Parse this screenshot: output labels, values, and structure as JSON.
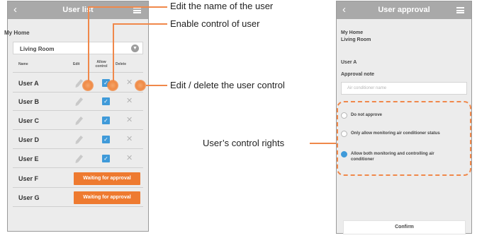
{
  "left_screen": {
    "title": "User list",
    "home": "My Home",
    "room": "Living Room",
    "columns": {
      "name": "Name",
      "edit": "Edit",
      "allow": "Allow control",
      "delete": "Delete"
    },
    "users": [
      {
        "name": "User A",
        "status": "approved"
      },
      {
        "name": "User B",
        "status": "approved"
      },
      {
        "name": "User C",
        "status": "approved"
      },
      {
        "name": "User D",
        "status": "approved"
      },
      {
        "name": "User E",
        "status": "approved"
      },
      {
        "name": "User F",
        "status": "Waiting for approval"
      },
      {
        "name": "User G",
        "status": "Waiting for approval"
      }
    ]
  },
  "right_screen": {
    "title": "User approval",
    "home": "My Home",
    "room": "Living Room",
    "user": "User A",
    "approval_note_label": "Approval note",
    "approval_note_placeholder": "Air conditioner name",
    "options": [
      {
        "label": "Do not approve",
        "selected": false
      },
      {
        "label": "Only allow monitoring air conditioner status",
        "selected": false
      },
      {
        "label": "Allow both monitoring and controlling air conditioner",
        "selected": true
      }
    ],
    "confirm": "Confirm"
  },
  "annotations": {
    "edit_name": "Edit the name of the user",
    "enable_control": "Enable control of user",
    "edit_delete": "Edit / delete the user control",
    "control_rights": "User’s control rights"
  },
  "colors": {
    "accent_orange": "#ee7a30",
    "check_blue": "#3f9ad9",
    "topbar_gray": "#a9a9a9"
  }
}
